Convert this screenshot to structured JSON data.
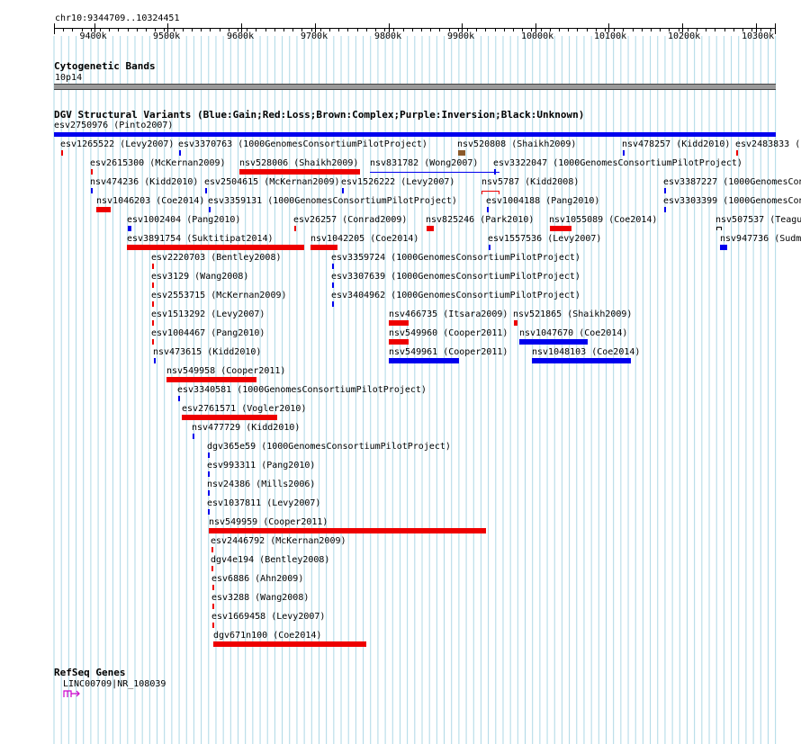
{
  "position": "chr10:9344709..10324451",
  "ruler": {
    "ticks": [
      "9400k",
      "9500k",
      "9600k",
      "9700k",
      "9800k",
      "9900k",
      "10000k",
      "10100k",
      "10200k",
      "10300k"
    ]
  },
  "cytoband": {
    "title": "Cytogenetic Bands",
    "band": "10p14"
  },
  "dgv": {
    "title": "DGV Structural Variants (Blue:Gain;Red:Loss;Brown:Complex;Purple:Inversion;Black:Unknown)",
    "legend_colors": {
      "gain": "#0000ee",
      "loss": "#ee0000",
      "complex": "#8b5a2b",
      "inversion": "#800080",
      "unknown": "#000000"
    },
    "features": [
      {
        "label": "esv2750976 (Pinto2007)",
        "color": "gain"
      },
      {
        "label": "esv1265522 (Levy2007)",
        "color": "loss"
      },
      {
        "label": "esv3370763 (1000GenomesConsortiumPilotProject)",
        "color": "gain"
      },
      {
        "label": "nsv520808 (Shaikh2009)",
        "color": "complex"
      },
      {
        "label": "nsv478257 (Kidd2010)",
        "color": "gain"
      },
      {
        "label": "esv2483833 (",
        "color": "loss"
      },
      {
        "label": "esv2615300 (McKernan2009)",
        "color": "loss"
      },
      {
        "label": "nsv528006 (Shaikh2009)",
        "color": "loss"
      },
      {
        "label": "nsv831782 (Wong2007)",
        "color": "gain"
      },
      {
        "label": "esv3322047 (1000GenomesConsortiumPilotProject)",
        "color": "gain"
      },
      {
        "label": "nsv474236 (Kidd2010)",
        "color": "gain"
      },
      {
        "label": "esv2504615 (McKernan2009)",
        "color": "gain"
      },
      {
        "label": "esv1526222 (Levy2007)",
        "color": "gain"
      },
      {
        "label": "nsv5787 (Kidd2008)",
        "color": "loss"
      },
      {
        "label": "esv3387227 (1000GenomesCon",
        "color": "gain"
      },
      {
        "label": "nsv1046203 (Coe2014)",
        "color": "loss"
      },
      {
        "label": "esv3359131 (1000GenomesConsortiumPilotProject)",
        "color": "gain"
      },
      {
        "label": "esv1004188 (Pang2010)",
        "color": "gain"
      },
      {
        "label": "esv3303399 (1000GenomesCon",
        "color": "gain"
      },
      {
        "label": "esv1002404 (Pang2010)",
        "color": "gain"
      },
      {
        "label": "esv26257 (Conrad2009)",
        "color": "loss"
      },
      {
        "label": "nsv825246 (Park2010)",
        "color": "loss"
      },
      {
        "label": "nsv1055089 (Coe2014)",
        "color": "loss"
      },
      {
        "label": "nsv507537 (Teagu",
        "color": "unknown"
      },
      {
        "label": "esv3891754 (Suktitipat2014)",
        "color": "loss"
      },
      {
        "label": "nsv1042205 (Coe2014)",
        "color": "loss"
      },
      {
        "label": "esv1557536 (Levy2007)",
        "color": "gain"
      },
      {
        "label": "nsv947736 (Sudm",
        "color": "gain"
      },
      {
        "label": "esv2220703 (Bentley2008)",
        "color": "loss"
      },
      {
        "label": "esv3359724 (1000GenomesConsortiumPilotProject)",
        "color": "gain"
      },
      {
        "label": "esv3129 (Wang2008)",
        "color": "loss"
      },
      {
        "label": "esv3307639 (1000GenomesConsortiumPilotProject)",
        "color": "gain"
      },
      {
        "label": "esv2553715 (McKernan2009)",
        "color": "loss"
      },
      {
        "label": "esv3404962 (1000GenomesConsortiumPilotProject)",
        "color": "gain"
      },
      {
        "label": "esv1513292 (Levy2007)",
        "color": "loss"
      },
      {
        "label": "nsv466735 (Itsara2009)",
        "color": "loss"
      },
      {
        "label": "nsv521865 (Shaikh2009)",
        "color": "loss"
      },
      {
        "label": "esv1004467 (Pang2010)",
        "color": "loss"
      },
      {
        "label": "nsv549960 (Cooper2011)",
        "color": "loss"
      },
      {
        "label": "nsv1047670 (Coe2014)",
        "color": "gain"
      },
      {
        "label": "nsv473615 (Kidd2010)",
        "color": "gain"
      },
      {
        "label": "nsv549961 (Cooper2011)",
        "color": "gain"
      },
      {
        "label": "nsv1048103 (Coe2014)",
        "color": "gain"
      },
      {
        "label": "nsv549958 (Cooper2011)",
        "color": "loss"
      },
      {
        "label": "esv3340581 (1000GenomesConsortiumPilotProject)",
        "color": "gain"
      },
      {
        "label": "esv2761571 (Vogler2010)",
        "color": "loss"
      },
      {
        "label": "nsv477729 (Kidd2010)",
        "color": "gain"
      },
      {
        "label": "dgv365e59 (1000GenomesConsortiumPilotProject)",
        "color": "gain"
      },
      {
        "label": "esv993311 (Pang2010)",
        "color": "gain"
      },
      {
        "label": "nsv24386 (Mills2006)",
        "color": "gain"
      },
      {
        "label": "esv1037811 (Levy2007)",
        "color": "gain"
      },
      {
        "label": "nsv549959 (Cooper2011)",
        "color": "loss"
      },
      {
        "label": "esv2446792 (McKernan2009)",
        "color": "loss"
      },
      {
        "label": "dgv4e194 (Bentley2008)",
        "color": "loss"
      },
      {
        "label": "esv6886 (Ahn2009)",
        "color": "loss"
      },
      {
        "label": "esv3288 (Wang2008)",
        "color": "loss"
      },
      {
        "label": "esv1669458 (Levy2007)",
        "color": "loss"
      },
      {
        "label": "dgv671n100 (Coe2014)",
        "color": "loss"
      }
    ]
  },
  "refseq": {
    "title": "RefSeq Genes",
    "gene_label": "LINC00709|NR_108039",
    "gene_color": "#cc00cc"
  }
}
